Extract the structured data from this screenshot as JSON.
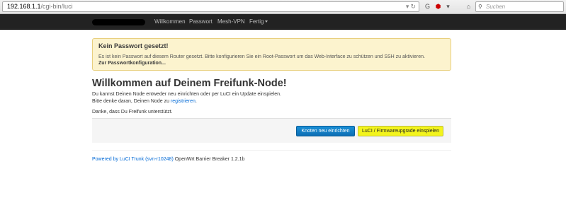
{
  "browser": {
    "url_host": "192.168.1.1",
    "url_path": "/cgi-bin/luci",
    "search_placeholder": "Suchen"
  },
  "navbar": {
    "items": [
      {
        "label": "Willkommen"
      },
      {
        "label": "Passwort"
      },
      {
        "label": "Mesh-VPN"
      },
      {
        "label": "Fertig"
      }
    ]
  },
  "alert": {
    "title": "Kein Passwort gesetzt!",
    "text": "Es ist kein Passwort auf diesem Router gesetzt. Bitte konfigurieren Sie ein Root-Passwort um das Web-Interface zu schützen und SSH zu aktivieren.",
    "link": "Zur Passwortkonfiguration..."
  },
  "main": {
    "heading": "Willkommen auf Deinem Freifunk-Node!",
    "line1": "Du kannst Deinen Node entweder neu einrichten oder per LuCI ein Update einspielen.",
    "line2_prefix": "Bitte denke daran, Deinen Node zu ",
    "line2_link": "registrieren",
    "line2_suffix": ".",
    "line3": "Danke, dass Du Freifunk unterstützt."
  },
  "actions": {
    "primary_label": "Knoten neu einrichten",
    "secondary_label": "LuCI / Firmwareupgrade einspielen"
  },
  "footer": {
    "link": "Powered by LuCI Trunk (svn-r10248)",
    "text": " OpenWrt Barrier Breaker 1.2.1b"
  },
  "colors": {
    "navbar_bg": "#222222",
    "alert_bg": "#fcf3ce",
    "primary_button": "#0d6eb4",
    "highlight": "#f3f41b",
    "link": "#0069d6"
  }
}
